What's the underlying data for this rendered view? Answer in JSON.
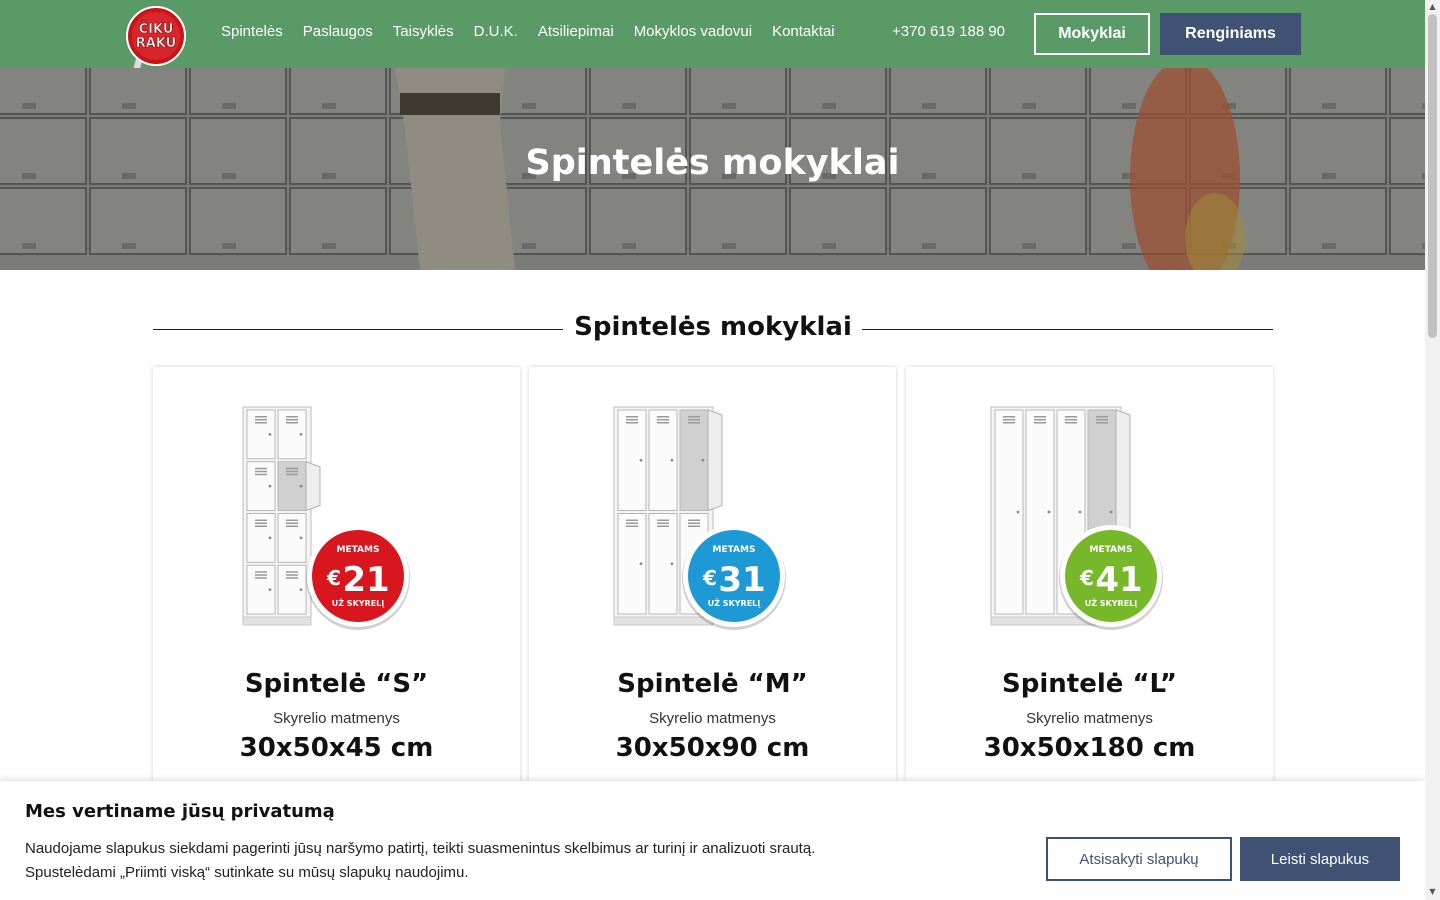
{
  "logo": {
    "text_line1": "ČIKU",
    "text_line2": "RAKU"
  },
  "nav": {
    "items": [
      {
        "label": "Spintelės"
      },
      {
        "label": "Paslaugos"
      },
      {
        "label": "Taisyklės"
      },
      {
        "label": "D.U.K."
      },
      {
        "label": "Atsiliepimai"
      },
      {
        "label": "Mokyklos vadovui"
      },
      {
        "label": "Kontaktai"
      }
    ],
    "phone": "+370 619 188 90",
    "btn_mokyklai": "Mokyklai",
    "btn_renginiams": "Renginiams"
  },
  "hero": {
    "title": "Spintelės mokyklai"
  },
  "section": {
    "title": "Spintelės mokyklai"
  },
  "cards": [
    {
      "name": "Spintelė “S”",
      "sub": "Skyrelio matmenys",
      "dim": "30x50x45 cm",
      "badge_top": "METAMS",
      "badge_price": "21",
      "badge_bottom": "UŽ SKYRELĮ",
      "badge_color": "#d7161d"
    },
    {
      "name": "Spintelė “M”",
      "sub": "Skyrelio matmenys",
      "dim": "30x50x90 cm",
      "badge_top": "METAMS",
      "badge_price": "31",
      "badge_bottom": "UŽ SKYRELĮ",
      "badge_color": "#1d9ad6"
    },
    {
      "name": "Spintelė “L”",
      "sub": "Skyrelio matmenys",
      "dim": "30x50x180 cm",
      "badge_top": "METAMS",
      "badge_price": "41",
      "badge_bottom": "UŽ SKYRELĮ",
      "badge_color": "#76b82a"
    }
  ],
  "badge_currency": "€",
  "cookie": {
    "title": "Mes vertiname jūsų privatumą",
    "text_line1": "Naudojame slapukus siekdami pagerinti jūsų naršymo patirtį, teikti suasmenintus skelbimus ar turinį ir analizuoti srautą.",
    "text_line2": "Spustelėdami „Priimti viską“ sutinkate su mūsų slapukų naudojimu.",
    "btn_reject": "Atsisakyti slapukų",
    "btn_accept": "Leisti slapukus"
  },
  "colors": {
    "header_bg": "#5a9a67",
    "button_dark": "#3f5274"
  }
}
